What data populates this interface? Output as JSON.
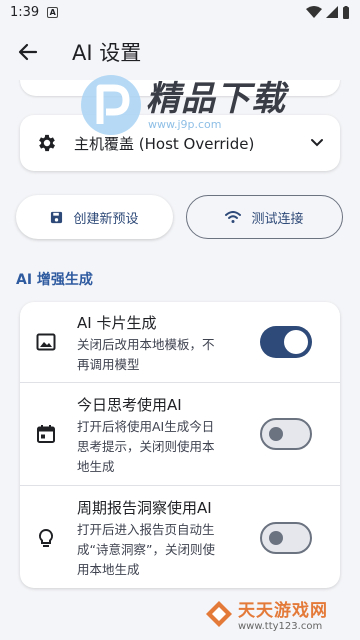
{
  "status_bar": {
    "time": "1:39",
    "badge": "A"
  },
  "app_bar": {
    "back_icon": "arrow-back-icon",
    "title": "AI 设置"
  },
  "watermark_top": {
    "brand": "精品下载",
    "url": "www.j9p.com"
  },
  "host_override": {
    "icon": "gear-icon",
    "label": "主机覆盖 (Host Override)"
  },
  "buttons": {
    "create_label": "创建新预设",
    "test_label": "测试连接"
  },
  "section": {
    "title": "AI 增强生成"
  },
  "features": [
    {
      "icon": "image-icon",
      "title": "AI 卡片生成",
      "desc_line1": "关闭后改用本地模板，不",
      "desc_line2": "再调用模型",
      "enabled": true
    },
    {
      "icon": "calendar-icon",
      "title": "今日思考使用AI",
      "desc_line1": "打开后将使用AI生成今日",
      "desc_line2": "思考提示，关闭则使用本",
      "desc_line3": "地生成",
      "enabled": false
    },
    {
      "icon": "lightbulb-icon",
      "title": "周期报告洞察使用AI",
      "desc_line1": "打开后进入报告页自动生",
      "desc_line2": "成“诗意洞察”，关闭则使",
      "desc_line3": "用本地生成",
      "enabled": false
    }
  ],
  "watermark_bottom": {
    "brand": "天天游戏网",
    "url": "www.tty123.com"
  },
  "colors": {
    "accent": "#2e4a78",
    "section": "#2e5aa0",
    "background": "#f4f5f8"
  }
}
